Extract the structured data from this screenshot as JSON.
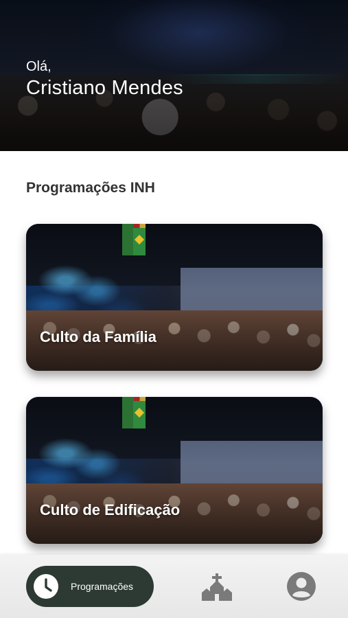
{
  "header": {
    "greeting": "Olá,",
    "user_name": "Cristiano Mendes"
  },
  "section": {
    "title": "Programações INH"
  },
  "cards": [
    {
      "title": "Culto da Família"
    },
    {
      "title": "Culto de Edificação"
    }
  ],
  "bottom_nav": {
    "items": [
      {
        "label": "Programações",
        "icon": "clock-icon",
        "active": true
      },
      {
        "label": "",
        "icon": "church-icon",
        "active": false
      },
      {
        "label": "",
        "icon": "profile-icon",
        "active": false
      }
    ]
  },
  "colors": {
    "nav_active_bg": "#2d3a33",
    "title_text": "#333333",
    "nav_icon": "#7a7a7a"
  }
}
